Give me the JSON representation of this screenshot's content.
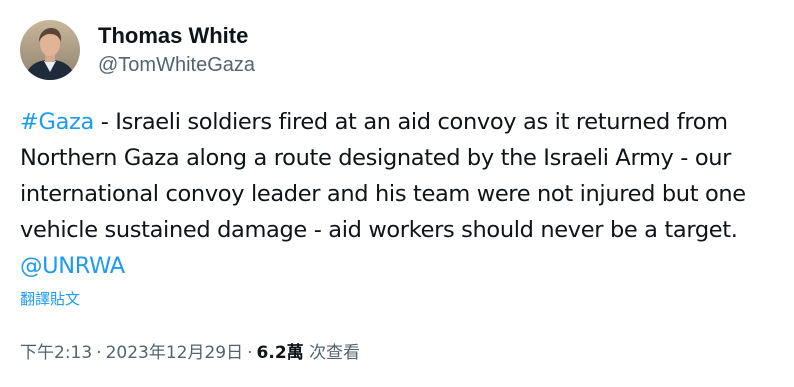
{
  "author": {
    "display_name": "Thomas White",
    "handle": "@TomWhiteGaza",
    "avatar_icon": "profile-photo"
  },
  "tweet": {
    "hashtag": "#Gaza",
    "text": " - Israeli soldiers fired at an aid convoy as it returned from Northern Gaza along a route designated by the Israeli Army - our international convoy leader and his team were not injured but one vehicle sustained damage - aid workers should never be a target. ",
    "mention": "@UNRWA"
  },
  "translate_label": "翻譯貼文",
  "meta": {
    "time": "下午2:13",
    "separator": "·",
    "date": "2023年12月29日",
    "views_count": "6.2萬",
    "views_label": "次查看"
  },
  "colors": {
    "link": "#1d9bf0",
    "primary_text": "#0f1419",
    "secondary_text": "#536471"
  }
}
